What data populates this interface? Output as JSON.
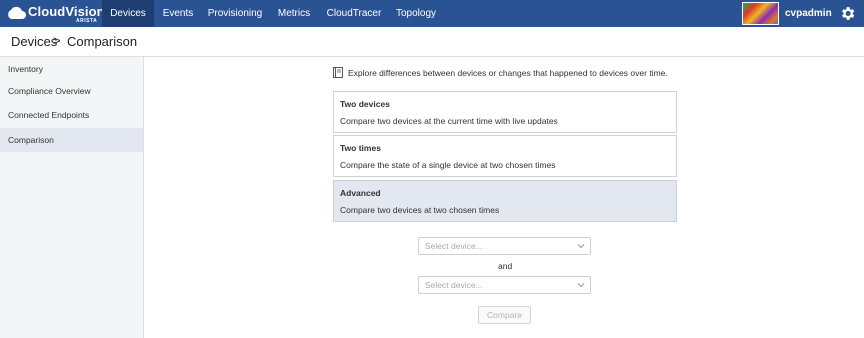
{
  "brand": {
    "name": "CloudVision",
    "sub": "ARISTA"
  },
  "nav": {
    "items": [
      {
        "label": "Devices",
        "active": true
      },
      {
        "label": "Events",
        "active": false
      },
      {
        "label": "Provisioning",
        "active": false
      },
      {
        "label": "Metrics",
        "active": false
      },
      {
        "label": "CloudTracer",
        "active": false
      },
      {
        "label": "Topology",
        "active": false
      }
    ],
    "username": "cvpadmin"
  },
  "breadcrumb": {
    "parent": "Devices",
    "separator": ">",
    "current": "Comparison"
  },
  "sidebar": {
    "items": [
      {
        "label": "Inventory"
      },
      {
        "label": "Compliance Overview"
      },
      {
        "label": "Connected Endpoints"
      },
      {
        "label": "Comparison",
        "active": true
      }
    ]
  },
  "main": {
    "intro": "Explore differences between devices or changes that happened to devices over time.",
    "options": [
      {
        "title": "Two devices",
        "description": "Compare two devices at the current time with live updates"
      },
      {
        "title": "Two times",
        "description": "Compare the state of a single device at two chosen times"
      },
      {
        "title": "Advanced",
        "description": "Compare two devices at two chosen times",
        "selected": true
      }
    ],
    "select_placeholder_1": "Select device...",
    "and_label": "and",
    "select_placeholder_2": "Select device...",
    "compare_label": "Compare"
  },
  "colors": {
    "nav_bg": "#2a5394",
    "nav_active": "#1e3d70",
    "selected_bg": "#e2e7f0"
  }
}
